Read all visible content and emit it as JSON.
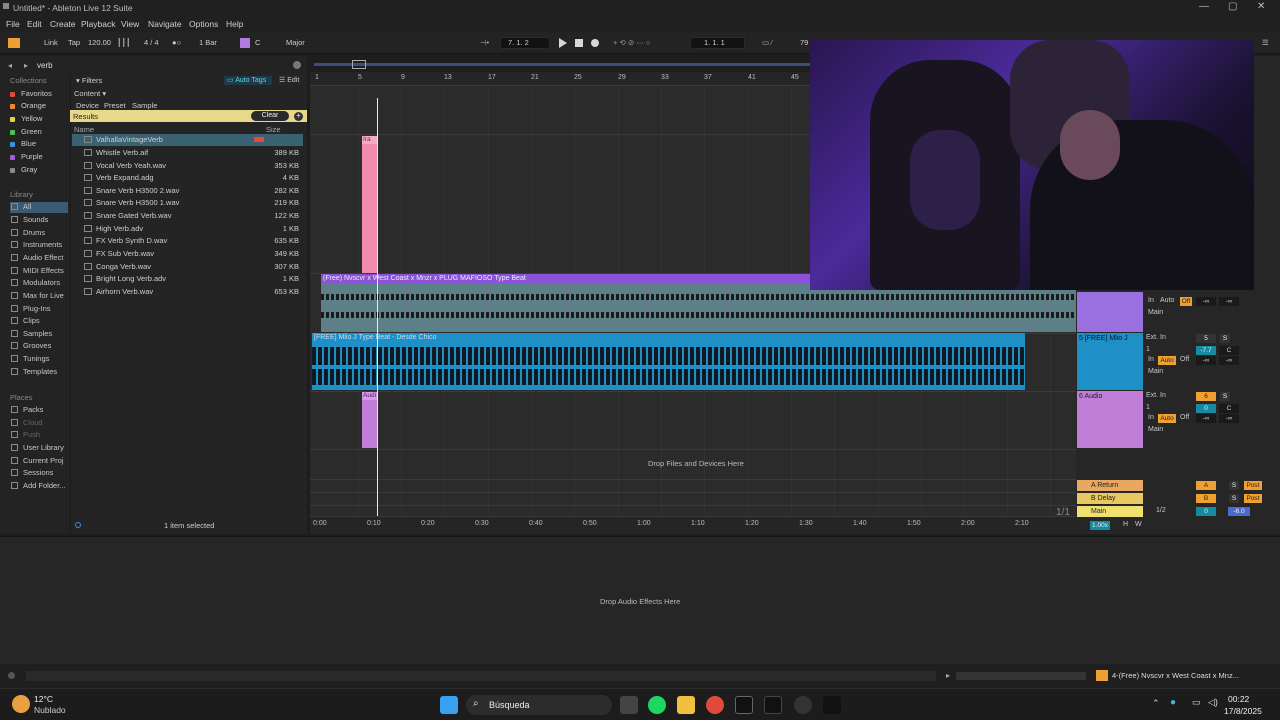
{
  "window": {
    "title": "Untitled* - Ableton Live 12 Suite",
    "min": "—",
    "max": "▢",
    "close": "✕"
  },
  "menu": [
    "File",
    "Edit",
    "Create",
    "Playback",
    "View",
    "Navigate",
    "Options",
    "Help"
  ],
  "control": {
    "link": "Link",
    "tap": "Tap",
    "tempo": "120.00",
    "sig": "4 / 4",
    "quant": "1 Bar",
    "key": "C",
    "scale": "Major",
    "pos": "7.  1.  2",
    "loop_start": "1.  1.  1",
    "zoom": "79"
  },
  "browser": {
    "search": "verb",
    "filters": "Filters",
    "auto_tags": "Auto Tags",
    "edit": "Edit",
    "content": "Content",
    "device": "Device",
    "preset": "Preset",
    "sample": "Sample",
    "results": "Results",
    "clear": "Clear",
    "col_name": "Name",
    "col_size": "Size",
    "collections_title": "Collections",
    "collections": [
      {
        "label": "Favoritos",
        "color": "#e34a3b"
      },
      {
        "label": "Orange",
        "color": "#ee8a2d"
      },
      {
        "label": "Yellow",
        "color": "#e8d23a"
      },
      {
        "label": "Green",
        "color": "#4ec04e"
      },
      {
        "label": "Blue",
        "color": "#3d8fe0"
      },
      {
        "label": "Purple",
        "color": "#a75ad8"
      },
      {
        "label": "Gray",
        "color": "#8a8a8a"
      }
    ],
    "library_title": "Library",
    "library": [
      "All",
      "Sounds",
      "Drums",
      "Instruments",
      "Audio Effect",
      "MIDI Effects",
      "Modulators",
      "Max for Live",
      "Plug-Ins",
      "Clips",
      "Samples",
      "Grooves",
      "Tunings",
      "Templates"
    ],
    "places_title": "Places",
    "places": [
      "Packs",
      "Cloud",
      "Push",
      "User Library",
      "Current Proj",
      "Sessions",
      "Add Folder..."
    ],
    "items": [
      {
        "name": "ValhallaVintageVerb",
        "size": ""
      },
      {
        "name": "Whistle Verb.aif",
        "size": "389 KB"
      },
      {
        "name": "Vocal Verb Yeah.wav",
        "size": "353 KB"
      },
      {
        "name": "Verb Expand.adg",
        "size": "4 KB"
      },
      {
        "name": "Snare Verb H3500 2.wav",
        "size": "282 KB"
      },
      {
        "name": "Snare Verb H3500 1.wav",
        "size": "219 KB"
      },
      {
        "name": "Snare Gated Verb.wav",
        "size": "122 KB"
      },
      {
        "name": "High Verb.adv",
        "size": "1 KB"
      },
      {
        "name": "FX Verb Synth D.wav",
        "size": "635 KB"
      },
      {
        "name": "FX Sub Verb.wav",
        "size": "349 KB"
      },
      {
        "name": "Conga Verb.wav",
        "size": "307 KB"
      },
      {
        "name": "Bright Long Verb.adv",
        "size": "1 KB"
      },
      {
        "name": "Airhorn Verb.wav",
        "size": "653 KB"
      }
    ],
    "selected_text": "1 item selected"
  },
  "arrangement": {
    "bars": [
      "1",
      "5",
      "9",
      "13",
      "17",
      "21",
      "25",
      "29",
      "33",
      "37",
      "41",
      "45"
    ],
    "times": [
      "0:00",
      "0:10",
      "0:20",
      "0:30",
      "0:40",
      "0:50",
      "1:00",
      "1:10",
      "1:20",
      "1:30",
      "1:40",
      "1:50",
      "2:00",
      "2:10"
    ],
    "clip_pink": "Ira",
    "clip_purple": "(Free) Nvscvr x West Coast x Mnzr x PLUG MAFIOSO Type Beat",
    "clip_blue": "[FREE] Mlio J Type Beat - Desde Chico",
    "clip_audio": "Audi",
    "drop_files": "Drop Files and Devices Here",
    "page": "1/1"
  },
  "mixer": {
    "t1": {
      "in": "In",
      "auto": "Auto",
      "off": "Off",
      "out": "Main",
      "vol": "-∞",
      "pan": "-∞"
    },
    "t2": {
      "name": "5 [FREE] Mlio J",
      "ext": "Ext. In",
      "num": "5",
      "s": "S",
      "ch": "1",
      "vol": "-7.7",
      "pan": "C",
      "in": "In",
      "auto": "Auto",
      "off": "Off",
      "out": "Main",
      "v2": "-∞",
      "p2": "-∞"
    },
    "t3": {
      "name": "6 Audio",
      "ext": "Ext. In",
      "num": "6",
      "s": "S",
      "ch": "1",
      "vol": "0",
      "pan": "C",
      "in": "In",
      "auto": "Auto",
      "off": "Off",
      "out": "Main",
      "v2": "-∞",
      "p2": "-∞"
    },
    "ret_a": "A Return",
    "ret_b": "B Delay",
    "main": "Main",
    "a": "A",
    "b": "B",
    "s": "S",
    "post": "Post",
    "half": "1/2",
    "mv": "0",
    "mdb": "-6.0",
    "zoom": "1.00x",
    "h": "H",
    "w": "W"
  },
  "device_panel": {
    "drop": "Drop Audio Effects Here"
  },
  "status": {
    "track": "4-(Free) Nvscvr x West Coast x Mnz..."
  },
  "taskbar": {
    "temp": "12°C",
    "weather": "Nublado",
    "search": "Búsqueda",
    "time": "00:22",
    "date": "17/8/2025"
  }
}
